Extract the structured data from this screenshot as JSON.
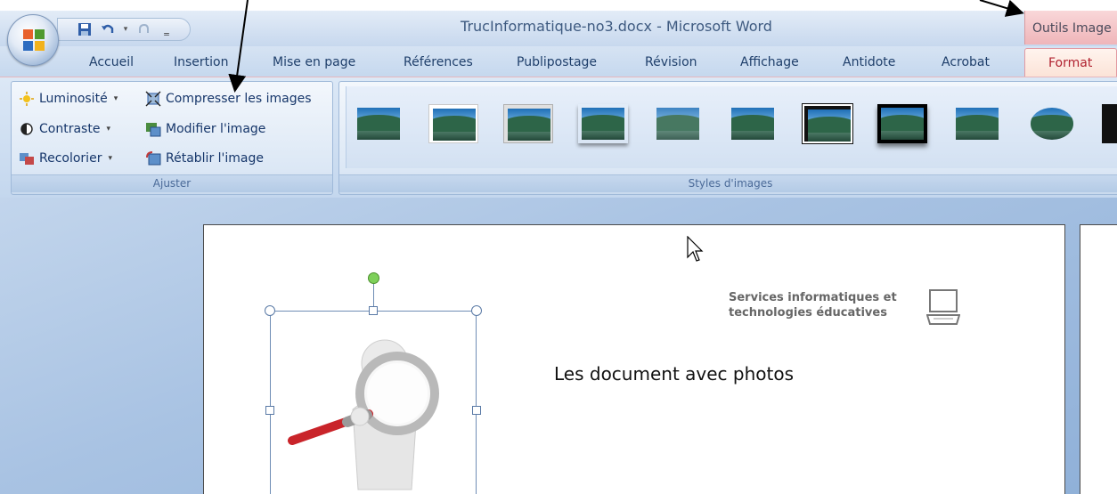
{
  "window": {
    "title": "TrucInformatique-no3.docx - Microsoft Word",
    "contextual_tab_group": "Outils Image"
  },
  "quick_access": {
    "save_icon": "save-icon",
    "undo_icon": "undo-icon",
    "redo_icon": "redo-icon",
    "customize_icon": "customize-icon"
  },
  "tabs": [
    {
      "label": "Accueil"
    },
    {
      "label": "Insertion"
    },
    {
      "label": "Mise en page"
    },
    {
      "label": "Références"
    },
    {
      "label": "Publipostage"
    },
    {
      "label": "Révision"
    },
    {
      "label": "Affichage"
    },
    {
      "label": "Antidote"
    },
    {
      "label": "Acrobat"
    },
    {
      "label": "Format"
    }
  ],
  "ribbon": {
    "adjust_group": {
      "label": "Ajuster",
      "brightness": "Luminosité",
      "contrast": "Contraste",
      "recolor": "Recolorier",
      "compress": "Compresser les images",
      "change": "Modifier l'image",
      "reset": "Rétablir l'image"
    },
    "styles_group": {
      "label": "Styles d'images"
    }
  },
  "document": {
    "body_text": "Les document avec photos",
    "logo_line1": "Services informatiques et",
    "logo_line2": "technologies éducatives"
  },
  "colors": {
    "accent": "#15428b",
    "contextual": "#efb5b9",
    "format_tab_text": "#b0202e"
  }
}
